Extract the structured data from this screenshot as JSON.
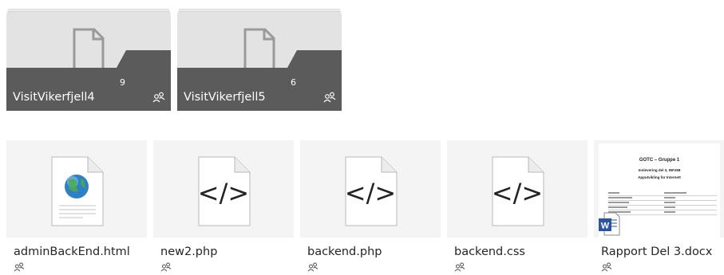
{
  "folders": [
    {
      "name": "VisitVikerfjell4",
      "count": "9",
      "icon": "document-icon",
      "shared_icon": "people-icon"
    },
    {
      "name": "VisitVikerfjell5",
      "count": "6",
      "icon": "document-icon",
      "shared_icon": "people-icon"
    }
  ],
  "files": [
    {
      "name": "adminBackEnd.html",
      "icon": "html-globe-icon",
      "shared_icon": "people-icon"
    },
    {
      "name": "new2.php",
      "icon": "code-file-icon",
      "glyph": "</>",
      "shared_icon": "people-icon"
    },
    {
      "name": "backend.php",
      "icon": "code-file-icon",
      "glyph": "</>",
      "shared_icon": "people-icon"
    },
    {
      "name": "backend.css",
      "icon": "code-file-icon",
      "glyph": "</>",
      "shared_icon": "people-icon"
    },
    {
      "name": "Rapport Del 3.docx",
      "icon": "word-icon",
      "shared_icon": "people-icon",
      "preview": {
        "title": "GOTC – Gruppe 1",
        "line1": "Innlevering del 3, INF268",
        "line2": "Apputvikling for Internett"
      }
    }
  ],
  "colors": {
    "folder_bar": "#5b5b5b",
    "folder_body": "#e3e3e3",
    "tile_bg": "#f4f4f4",
    "word_blue": "#2b579a"
  }
}
